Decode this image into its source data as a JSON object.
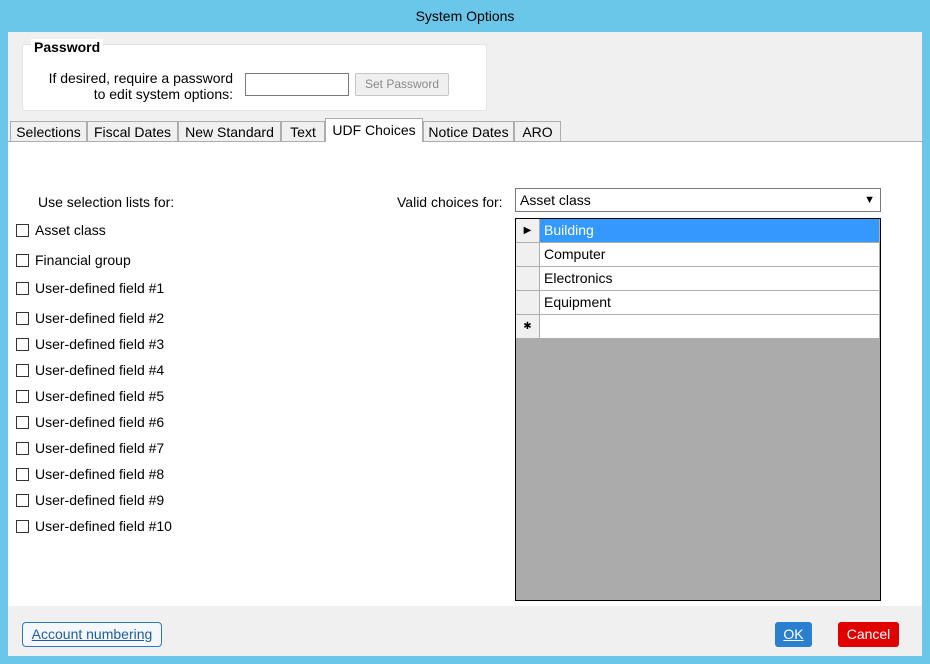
{
  "window": {
    "title": "System Options"
  },
  "password": {
    "legend": "Password",
    "prompt_line1": "If desired, require a password",
    "prompt_line2": "to edit system options:",
    "value": "",
    "set_button": "Set Password"
  },
  "tabs": [
    "Selections",
    "Fiscal Dates",
    "New Standard",
    "Text",
    "UDF Choices",
    "Notice Dates",
    "ARO"
  ],
  "active_tab": "UDF Choices",
  "udf": {
    "use_lists_label": "Use selection lists for:",
    "checkboxes": [
      "Asset class",
      "Financial group",
      "User-defined field #1",
      "User-defined field #2",
      "User-defined field #3",
      "User-defined field #4",
      "User-defined field #5",
      "User-defined field #6",
      "User-defined field #7",
      "User-defined field #8",
      "User-defined field #9",
      "User-defined field #10"
    ],
    "valid_choices_label": "Valid choices for:",
    "valid_choices_selected": "Asset class",
    "choices": [
      "Building",
      "Computer",
      "Electronics",
      "Equipment"
    ],
    "selected_choice": "Building"
  },
  "footer": {
    "account_numbering": "Account numbering",
    "ok": "OK",
    "cancel": "Cancel"
  },
  "colors": {
    "title_bar": "#6bc7ea",
    "selection": "#3399ff",
    "ok": "#2a7fd0",
    "cancel": "#e00000"
  }
}
